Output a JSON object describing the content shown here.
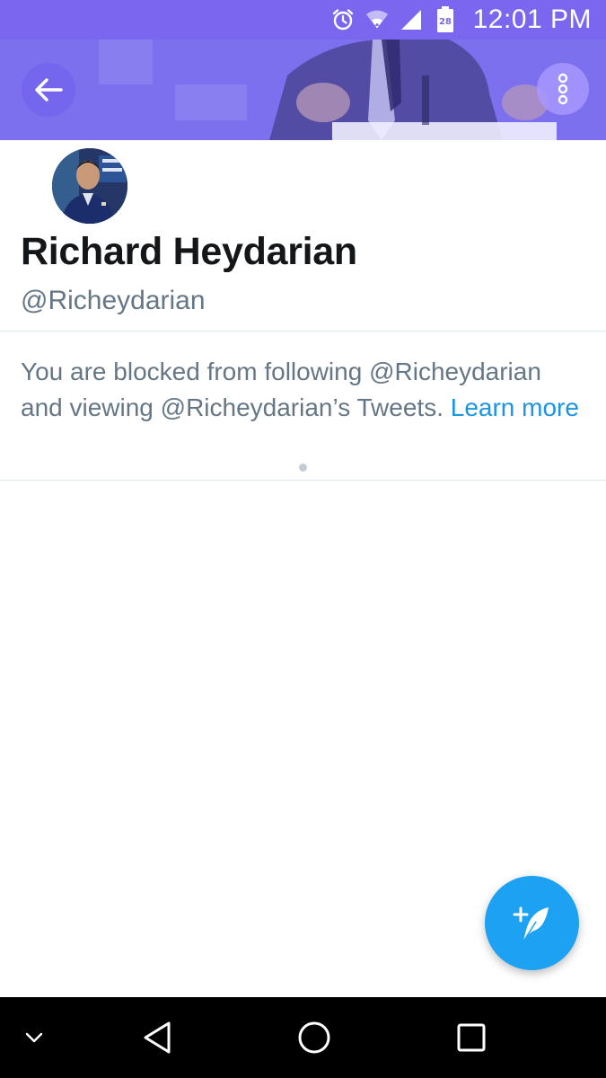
{
  "status_bar": {
    "time": "12:01 PM",
    "calendar_day": "28",
    "icons": [
      "alarm-icon",
      "wifi-icon",
      "signal-icon",
      "battery-icon"
    ]
  },
  "header": {
    "back_icon": "arrow-left-icon",
    "more_icon": "more-vertical-icon"
  },
  "profile": {
    "name": "Richard Heydarian",
    "handle": "@Richeydarian"
  },
  "blocked": {
    "message": "You are blocked from following @Richeydarian and viewing @Richeydarian’s Tweets. ",
    "link": "Learn more"
  },
  "fab": {
    "icon": "compose-tweet-icon"
  },
  "nav": {
    "icons": [
      "chevron-down-icon",
      "back-triangle-icon",
      "home-circle-icon",
      "recents-square-icon"
    ]
  },
  "colors": {
    "status_bar": "#7b66f0",
    "accent": "#1da1f2",
    "link": "#1b95e0",
    "text_primary": "#14171a",
    "text_secondary": "#657786"
  }
}
